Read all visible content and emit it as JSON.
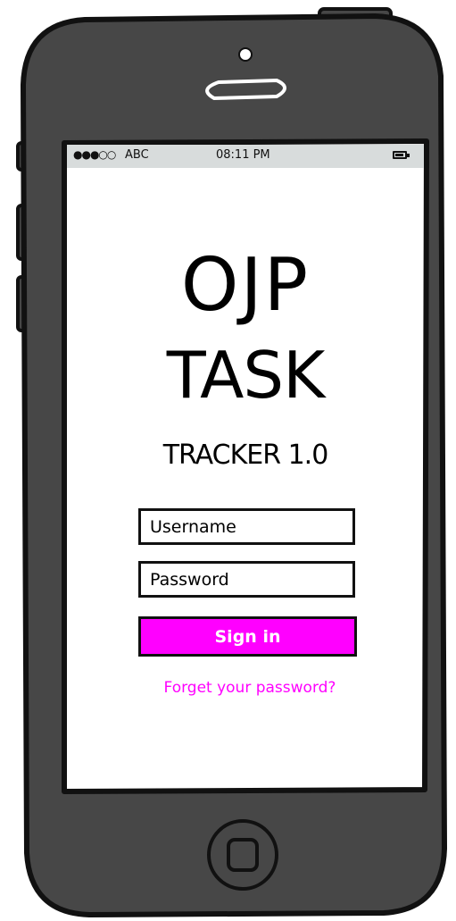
{
  "status_bar": {
    "signal": "●●●○○",
    "carrier": "ABC",
    "time": "08:11 PM",
    "battery_icon": "battery-icon"
  },
  "app": {
    "title_line1": "OJP",
    "title_line2": "TASK",
    "title_line3": "TRACKER 1.0"
  },
  "login": {
    "username_placeholder": "Username",
    "password_placeholder": "Password",
    "signin_label": "Sign in",
    "forgot_label": "Forget your password?"
  },
  "colors": {
    "phone_body": "#474747",
    "phone_outline": "#111111",
    "status_bar_bg": "#d8dcdc",
    "accent": "#ff00ff",
    "screen_bg": "#ffffff"
  }
}
